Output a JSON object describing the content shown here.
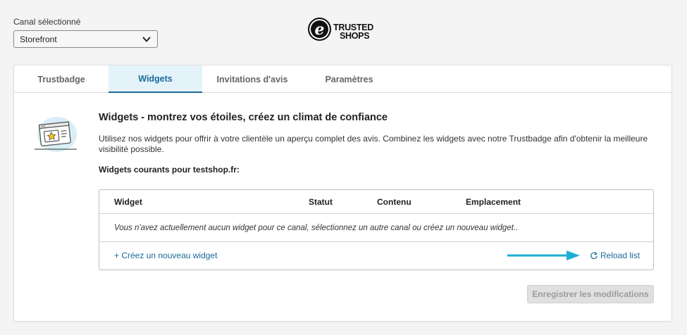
{
  "channel": {
    "label": "Canal sélectionné",
    "selected": "Storefront"
  },
  "logo": {
    "mark": "e",
    "line1": "TRUSTED",
    "line2": "SHOPS"
  },
  "tabs": [
    {
      "label": "Trustbadge",
      "active": false
    },
    {
      "label": "Widgets",
      "active": true
    },
    {
      "label": "Invitations d'avis",
      "active": false
    },
    {
      "label": "Paramètres",
      "active": false
    }
  ],
  "content": {
    "title": "Widgets - montrez vos étoiles, créez un climat de confiance",
    "description": "Utilisez nos widgets pour offrir à votre clientèle un aperçu complet des avis. Combinez les widgets avec notre Trustbadge afin d'obtenir la meilleure visibilité possible.",
    "current_widgets": "Widgets courants pour testshop.fr:"
  },
  "table": {
    "columns": [
      "Widget",
      "Statut",
      "Contenu",
      "Emplacement"
    ],
    "empty_message": "Vous n'avez actuellement aucun widget pour ce canal, sélectionnez un autre canal ou créez un nouveau widget..",
    "create_link": "+ Créez un nouveau widget",
    "reload_link": "Reload list"
  },
  "actions": {
    "save": "Enregistrer les modifications"
  },
  "colors": {
    "accent": "#1a6a9a",
    "active_tab_bg": "#e4f3fa",
    "annotation_arrow": "#1aaed6"
  }
}
